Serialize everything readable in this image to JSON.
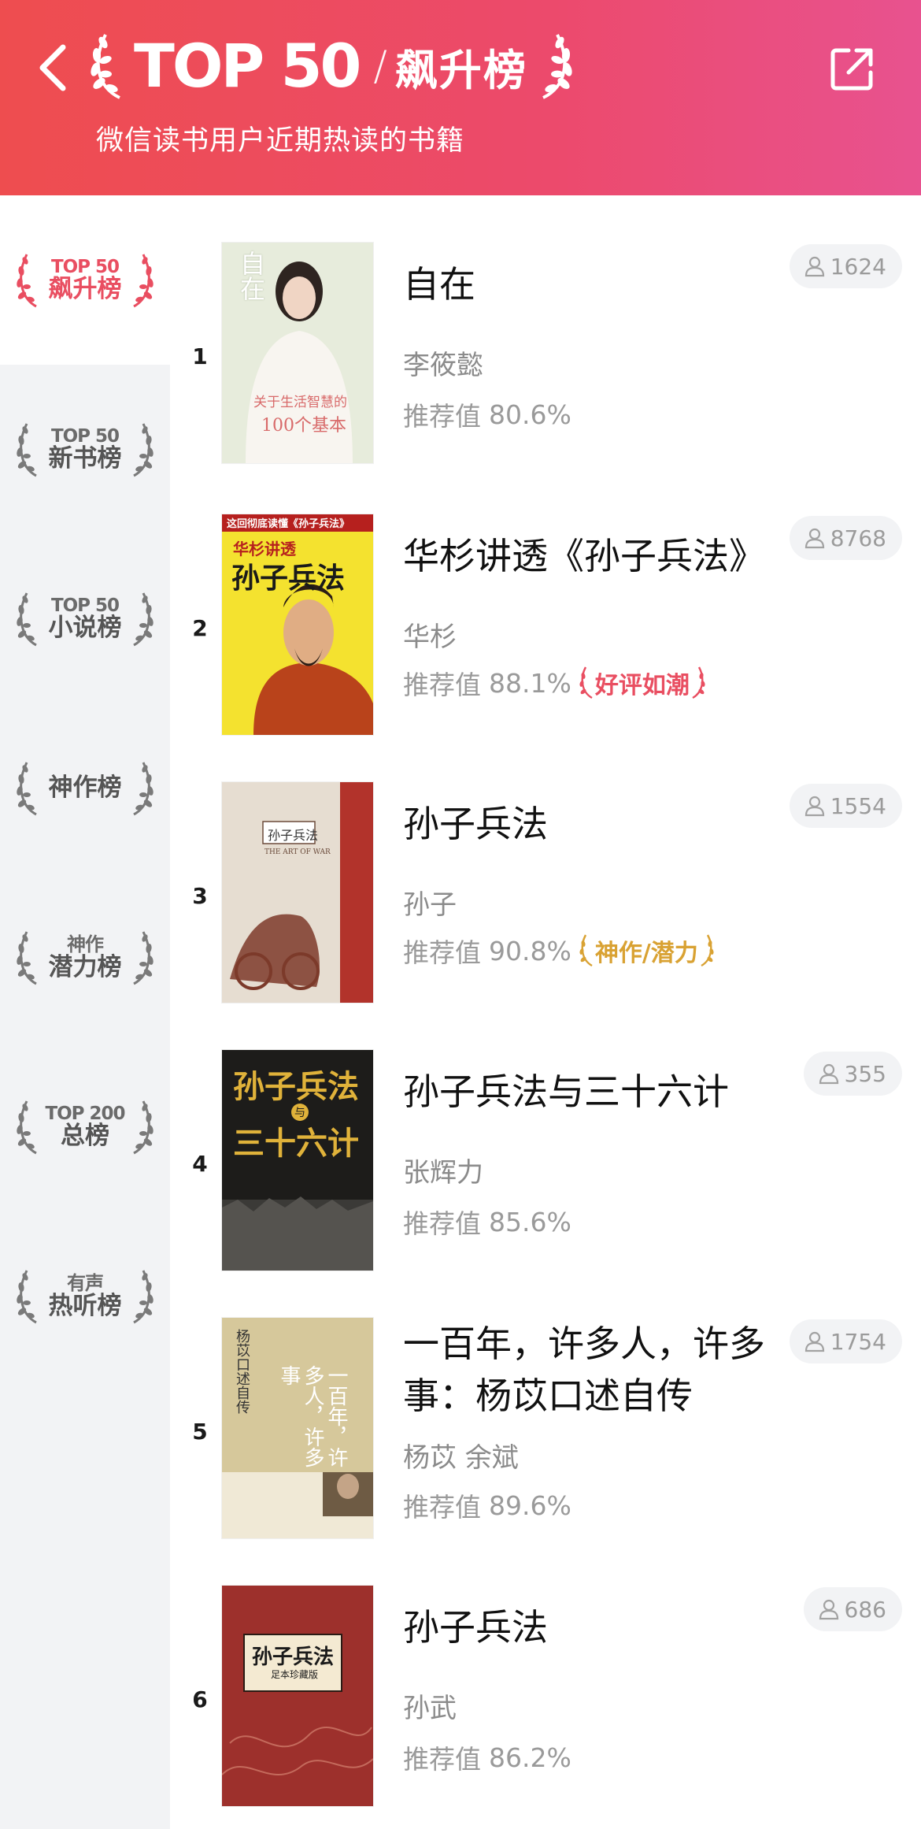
{
  "header": {
    "brand": "TOP 50",
    "slash": "/",
    "title": "飙升榜",
    "subtitle": "微信读书用户近期热读的书籍",
    "colors": {
      "gradient_start": "#ee4d4f",
      "gradient_end": "#e8528f"
    },
    "icons": {
      "back": "chevron-left-icon",
      "share": "share-external-icon"
    }
  },
  "sidebar": {
    "items": [
      {
        "top": "TOP 50",
        "label": "飙升榜",
        "active": true
      },
      {
        "top": "TOP 50",
        "label": "新书榜",
        "active": false
      },
      {
        "top": "TOP 50",
        "label": "小说榜",
        "active": false
      },
      {
        "top": "",
        "label": "神作榜",
        "active": false
      },
      {
        "top": "神作",
        "label": "潜力榜",
        "active": false
      },
      {
        "top": "TOP 200",
        "label": "总榜",
        "active": false
      },
      {
        "top": "有声",
        "label": "热听榜",
        "active": false
      }
    ]
  },
  "books": [
    {
      "rank": "1",
      "title": "自在",
      "author": "李筱懿",
      "rec_label": "推荐值",
      "rec_value": "80.6%",
      "readers": "1624",
      "badge": "",
      "cover": {
        "line1": "自在",
        "line2": "关于生活智慧的",
        "line3": "100个基本"
      }
    },
    {
      "rank": "2",
      "title": "华杉讲透《孙子兵法》",
      "author": "华杉",
      "rec_label": "推荐值",
      "rec_value": "88.1%",
      "readers": "8768",
      "badge": "好评如潮",
      "badge_color": "#e94e61",
      "cover": {
        "line1": "这回彻底读懂《孙子兵法》",
        "line2": "华杉讲透",
        "line3": "孙子兵法"
      }
    },
    {
      "rank": "3",
      "title": "孙子兵法",
      "author": "孙子",
      "rec_label": "推荐值",
      "rec_value": "90.8%",
      "readers": "1554",
      "badge": "神作/潜力",
      "badge_color": "#d9a233",
      "cover": {
        "line1": "孙子兵法",
        "line2": "THE ART OF WAR"
      }
    },
    {
      "rank": "4",
      "title": "孙子兵法与三十六计",
      "author": "张辉力",
      "rec_label": "推荐值",
      "rec_value": "85.6%",
      "readers": "355",
      "badge": "",
      "cover": {
        "line1": "孙子兵法",
        "line2": "三十六计",
        "line3": "与"
      }
    },
    {
      "rank": "5",
      "title": "一百年，许多人，许多事：杨苡口述自传",
      "author": "杨苡 余斌",
      "rec_label": "推荐值",
      "rec_value": "89.6%",
      "readers": "1754",
      "badge": "",
      "cover": {
        "line1": "杨苡口述自传",
        "line2": "一百年，许多人，许多事"
      }
    },
    {
      "rank": "6",
      "title": "孙子兵法",
      "author": "孙武",
      "rec_label": "推荐值",
      "rec_value": "86.2%",
      "readers": "686",
      "badge": "",
      "cover": {
        "line1": "孙子兵法",
        "line2": "足本珍藏版"
      }
    }
  ]
}
